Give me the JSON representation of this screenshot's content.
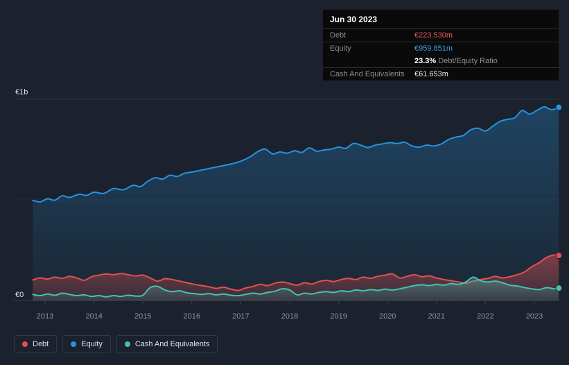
{
  "background": "#1b222d",
  "tooltip": {
    "date": "Jun 30 2023",
    "debt_label": "Debt",
    "debt_value": "€223.530m",
    "equity_label": "Equity",
    "equity_value": "€959.851m",
    "ratio_value": "23.3%",
    "ratio_label": " Debt/Equity Ratio",
    "cash_label": "Cash And Equivalents",
    "cash_value": "€61.653m"
  },
  "legend": [
    {
      "label": "Debt",
      "color": "#e25050"
    },
    {
      "label": "Equity",
      "color": "#2693df"
    },
    {
      "label": "Cash And Equivalents",
      "color": "#42c3b2"
    }
  ],
  "chart_data": {
    "type": "area",
    "title": "",
    "ylabel_top": "€1b",
    "ylabel_bottom": "€0",
    "ylim": [
      0,
      1000
    ],
    "x_ticks": [
      2013,
      2014,
      2015,
      2016,
      2017,
      2018,
      2019,
      2020,
      2021,
      2022,
      2023
    ],
    "xlim": [
      2012.36,
      2023.55
    ],
    "grid": true,
    "legend_position": "bottom-left",
    "series": [
      {
        "name": "Debt",
        "color": "#e25050",
        "fill_opacity_top": 0.5,
        "fill_opacity_bottom": 0.14,
        "end_value_label": "€223.530m",
        "points": [
          [
            2012.75,
            102
          ],
          [
            2012.9,
            112
          ],
          [
            2013.05,
            106
          ],
          [
            2013.2,
            116
          ],
          [
            2013.35,
            110
          ],
          [
            2013.5,
            120
          ],
          [
            2013.65,
            112
          ],
          [
            2013.8,
            100
          ],
          [
            2013.95,
            118
          ],
          [
            2014.1,
            126
          ],
          [
            2014.25,
            132
          ],
          [
            2014.4,
            128
          ],
          [
            2014.55,
            134
          ],
          [
            2014.7,
            128
          ],
          [
            2014.85,
            122
          ],
          [
            2015.0,
            126
          ],
          [
            2015.15,
            112
          ],
          [
            2015.3,
            96
          ],
          [
            2015.45,
            108
          ],
          [
            2015.6,
            104
          ],
          [
            2015.75,
            96
          ],
          [
            2015.9,
            88
          ],
          [
            2016.05,
            80
          ],
          [
            2016.2,
            74
          ],
          [
            2016.35,
            68
          ],
          [
            2016.5,
            60
          ],
          [
            2016.65,
            66
          ],
          [
            2016.8,
            56
          ],
          [
            2016.95,
            50
          ],
          [
            2017.1,
            62
          ],
          [
            2017.25,
            70
          ],
          [
            2017.4,
            80
          ],
          [
            2017.55,
            74
          ],
          [
            2017.7,
            86
          ],
          [
            2017.85,
            92
          ],
          [
            2018.0,
            84
          ],
          [
            2018.15,
            76
          ],
          [
            2018.3,
            88
          ],
          [
            2018.45,
            82
          ],
          [
            2018.6,
            94
          ],
          [
            2018.75,
            100
          ],
          [
            2018.9,
            94
          ],
          [
            2019.05,
            104
          ],
          [
            2019.2,
            110
          ],
          [
            2019.35,
            104
          ],
          [
            2019.5,
            116
          ],
          [
            2019.65,
            110
          ],
          [
            2019.8,
            120
          ],
          [
            2019.95,
            126
          ],
          [
            2020.1,
            132
          ],
          [
            2020.25,
            112
          ],
          [
            2020.4,
            120
          ],
          [
            2020.55,
            128
          ],
          [
            2020.7,
            118
          ],
          [
            2020.85,
            122
          ],
          [
            2021.0,
            112
          ],
          [
            2021.15,
            104
          ],
          [
            2021.3,
            98
          ],
          [
            2021.45,
            92
          ],
          [
            2021.6,
            86
          ],
          [
            2021.75,
            96
          ],
          [
            2021.9,
            104
          ],
          [
            2022.05,
            110
          ],
          [
            2022.2,
            120
          ],
          [
            2022.35,
            112
          ],
          [
            2022.5,
            118
          ],
          [
            2022.65,
            128
          ],
          [
            2022.8,
            142
          ],
          [
            2022.95,
            168
          ],
          [
            2023.1,
            188
          ],
          [
            2023.25,
            214
          ],
          [
            2023.4,
            226
          ],
          [
            2023.5,
            223.53
          ]
        ]
      },
      {
        "name": "Equity",
        "color": "#2693df",
        "fill_opacity_top": 0.3,
        "fill_opacity_bottom": 0.04,
        "end_value_label": "€959.851m",
        "points": [
          [
            2012.75,
            497
          ],
          [
            2012.9,
            490
          ],
          [
            2013.05,
            505
          ],
          [
            2013.2,
            498
          ],
          [
            2013.35,
            520
          ],
          [
            2013.5,
            512
          ],
          [
            2013.7,
            528
          ],
          [
            2013.85,
            522
          ],
          [
            2014.0,
            538
          ],
          [
            2014.2,
            532
          ],
          [
            2014.4,
            556
          ],
          [
            2014.6,
            550
          ],
          [
            2014.8,
            572
          ],
          [
            2014.95,
            566
          ],
          [
            2015.1,
            592
          ],
          [
            2015.25,
            610
          ],
          [
            2015.4,
            603
          ],
          [
            2015.55,
            622
          ],
          [
            2015.7,
            616
          ],
          [
            2015.85,
            632
          ],
          [
            2016.0,
            638
          ],
          [
            2016.2,
            648
          ],
          [
            2016.4,
            658
          ],
          [
            2016.6,
            668
          ],
          [
            2016.8,
            678
          ],
          [
            2017.0,
            692
          ],
          [
            2017.2,
            715
          ],
          [
            2017.35,
            740
          ],
          [
            2017.5,
            752
          ],
          [
            2017.65,
            728
          ],
          [
            2017.8,
            738
          ],
          [
            2017.95,
            732
          ],
          [
            2018.1,
            744
          ],
          [
            2018.25,
            736
          ],
          [
            2018.4,
            758
          ],
          [
            2018.55,
            742
          ],
          [
            2018.7,
            748
          ],
          [
            2018.85,
            752
          ],
          [
            2019.0,
            762
          ],
          [
            2019.15,
            756
          ],
          [
            2019.3,
            780
          ],
          [
            2019.45,
            772
          ],
          [
            2019.6,
            760
          ],
          [
            2019.75,
            772
          ],
          [
            2019.9,
            778
          ],
          [
            2020.05,
            784
          ],
          [
            2020.2,
            780
          ],
          [
            2020.35,
            786
          ],
          [
            2020.5,
            768
          ],
          [
            2020.65,
            762
          ],
          [
            2020.8,
            772
          ],
          [
            2020.95,
            768
          ],
          [
            2021.1,
            778
          ],
          [
            2021.25,
            800
          ],
          [
            2021.4,
            812
          ],
          [
            2021.55,
            820
          ],
          [
            2021.7,
            848
          ],
          [
            2021.85,
            856
          ],
          [
            2022.0,
            842
          ],
          [
            2022.15,
            866
          ],
          [
            2022.3,
            890
          ],
          [
            2022.45,
            900
          ],
          [
            2022.6,
            908
          ],
          [
            2022.75,
            944
          ],
          [
            2022.9,
            926
          ],
          [
            2023.05,
            944
          ],
          [
            2023.2,
            962
          ],
          [
            2023.35,
            948
          ],
          [
            2023.5,
            959.851
          ]
        ]
      },
      {
        "name": "Cash And Equivalents",
        "color": "#42c3b2",
        "fill_opacity_top": 0.4,
        "fill_opacity_bottom": 0.1,
        "end_value_label": "€61.653m",
        "points": [
          [
            2012.75,
            30
          ],
          [
            2012.9,
            24
          ],
          [
            2013.05,
            32
          ],
          [
            2013.2,
            26
          ],
          [
            2013.35,
            36
          ],
          [
            2013.5,
            30
          ],
          [
            2013.65,
            24
          ],
          [
            2013.8,
            28
          ],
          [
            2013.95,
            20
          ],
          [
            2014.1,
            24
          ],
          [
            2014.25,
            18
          ],
          [
            2014.4,
            24
          ],
          [
            2014.55,
            20
          ],
          [
            2014.7,
            26
          ],
          [
            2014.85,
            22
          ],
          [
            2015.0,
            26
          ],
          [
            2015.15,
            64
          ],
          [
            2015.3,
            70
          ],
          [
            2015.45,
            52
          ],
          [
            2015.6,
            44
          ],
          [
            2015.75,
            48
          ],
          [
            2015.9,
            38
          ],
          [
            2016.05,
            34
          ],
          [
            2016.2,
            30
          ],
          [
            2016.35,
            34
          ],
          [
            2016.5,
            28
          ],
          [
            2016.65,
            32
          ],
          [
            2016.8,
            26
          ],
          [
            2016.95,
            24
          ],
          [
            2017.1,
            30
          ],
          [
            2017.25,
            36
          ],
          [
            2017.4,
            32
          ],
          [
            2017.55,
            40
          ],
          [
            2017.7,
            46
          ],
          [
            2017.85,
            58
          ],
          [
            2018.0,
            52
          ],
          [
            2018.15,
            28
          ],
          [
            2018.3,
            36
          ],
          [
            2018.45,
            32
          ],
          [
            2018.6,
            40
          ],
          [
            2018.75,
            44
          ],
          [
            2018.9,
            40
          ],
          [
            2019.05,
            48
          ],
          [
            2019.2,
            44
          ],
          [
            2019.35,
            52
          ],
          [
            2019.5,
            48
          ],
          [
            2019.65,
            54
          ],
          [
            2019.8,
            50
          ],
          [
            2019.95,
            56
          ],
          [
            2020.1,
            52
          ],
          [
            2020.25,
            58
          ],
          [
            2020.4,
            66
          ],
          [
            2020.55,
            74
          ],
          [
            2020.7,
            78
          ],
          [
            2020.85,
            74
          ],
          [
            2021.0,
            80
          ],
          [
            2021.15,
            76
          ],
          [
            2021.3,
            84
          ],
          [
            2021.45,
            80
          ],
          [
            2021.6,
            92
          ],
          [
            2021.75,
            116
          ],
          [
            2021.9,
            98
          ],
          [
            2022.05,
            92
          ],
          [
            2022.2,
            96
          ],
          [
            2022.35,
            88
          ],
          [
            2022.5,
            76
          ],
          [
            2022.65,
            72
          ],
          [
            2022.8,
            64
          ],
          [
            2022.95,
            58
          ],
          [
            2023.1,
            54
          ],
          [
            2023.25,
            64
          ],
          [
            2023.4,
            58
          ],
          [
            2023.5,
            61.653
          ]
        ]
      }
    ],
    "colors": {
      "background": "#1b222d",
      "grid_top": "#2c3644",
      "grid_mid": "#232c38",
      "grid_zero": "#39434f",
      "axis_label": "#dfe5ea",
      "tick_label": "#8d98a5"
    }
  }
}
